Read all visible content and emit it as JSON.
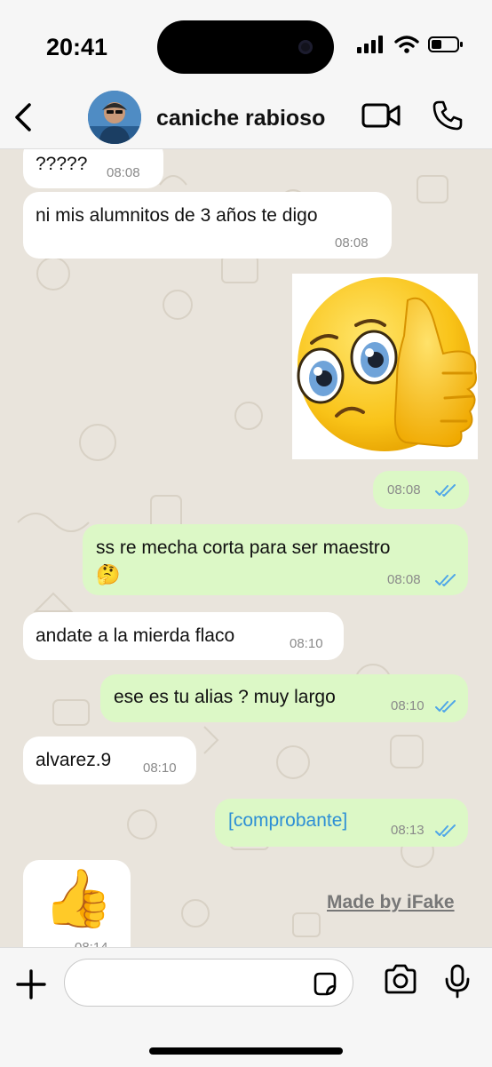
{
  "status": {
    "time": "20:41"
  },
  "header": {
    "contact_name": "caniche rabioso"
  },
  "messages": [
    {
      "dir": "in",
      "text": "?????",
      "time": "08:08"
    },
    {
      "dir": "in",
      "text": "ni mis alumnitos de 3 años te digo",
      "time": "08:08"
    },
    {
      "dir": "out",
      "type": "sticker",
      "time": "08:08",
      "read": true
    },
    {
      "dir": "out",
      "text": "ss re mecha corta para ser maestro",
      "emoji": "🤔",
      "time": "08:08",
      "read": true
    },
    {
      "dir": "in",
      "text": "andate a la mierda flaco",
      "time": "08:10"
    },
    {
      "dir": "out",
      "text": "ese es tu alias ? muy largo",
      "time": "08:10",
      "read": true
    },
    {
      "dir": "in",
      "text": "alvarez.9",
      "time": "08:10"
    },
    {
      "dir": "out",
      "text": "[comprobante]",
      "time": "08:13",
      "read": true
    },
    {
      "dir": "in",
      "type": "emoji",
      "emoji": "👍",
      "time": "08:14"
    }
  ],
  "watermark": "Made by iFake",
  "colors": {
    "incoming": "#ffffff",
    "outgoing": "#dcf8c6",
    "wallpaper": "#e9e4dc",
    "read_ticks": "#4fa6e8",
    "link": "#2d8fd5"
  },
  "icons": [
    "back-chevron-icon",
    "video-call-icon",
    "phone-call-icon",
    "plus-icon",
    "sticker-icon",
    "camera-icon",
    "microphone-icon",
    "signal-icon",
    "wifi-icon",
    "battery-icon"
  ]
}
